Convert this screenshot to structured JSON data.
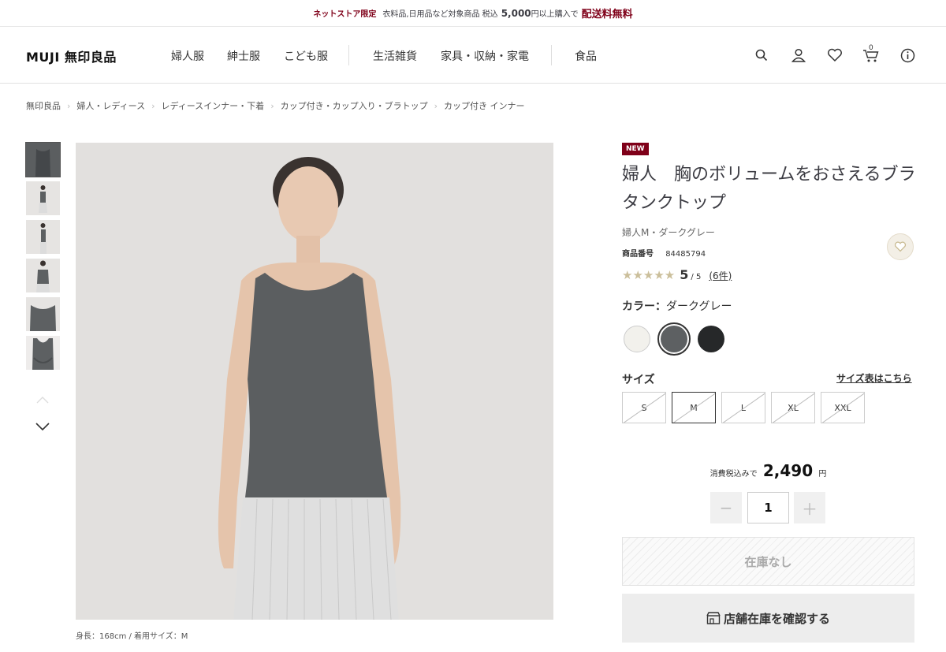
{
  "promo": {
    "tag": "ネットストア限定",
    "text": "衣料品,日用品など対象商品 税込",
    "amount": "5,000",
    "suffix": "円以上購入で",
    "highlight": "配送料無料"
  },
  "header": {
    "logo": "MUJI 無印良品",
    "nav": [
      "婦人服",
      "紳士服",
      "こども服",
      "生活雑貨",
      "家具・収納・家電",
      "食品"
    ],
    "icons": [
      "search-icon",
      "account-icon",
      "heart-icon",
      "cart-icon",
      "info-icon"
    ],
    "cart_count": "0"
  },
  "breadcrumb": [
    "無印良品",
    "婦人・レディース",
    "レディースインナー・下着",
    "カップ付き・カップ入り・ブラトップ",
    "カップ付き インナー"
  ],
  "gallery": {
    "thumb_count": 6,
    "caption": "身長：168cm / 着用サイズ：M"
  },
  "product": {
    "badge": "NEW",
    "title": "婦人　胸のボリュームをおさえるブラタンクトップ",
    "variant": "婦人M・ダークグレー",
    "sku_label": "商品番号",
    "sku": "84485794",
    "stars": "★★★★★",
    "score": "5",
    "out_of": "/ 5",
    "reviews": "(6件)",
    "color_label": "カラー：",
    "color_value": "ダークグレー",
    "colors": [
      {
        "name": "オフ白",
        "hex": "#f2f1ec"
      },
      {
        "name": "ダークグレー",
        "hex": "#5d6062"
      },
      {
        "name": "黒",
        "hex": "#262829"
      }
    ],
    "size_label": "サイズ",
    "size_chart_link": "サイズ表はこちら",
    "sizes": [
      "S",
      "M",
      "L",
      "XL",
      "XXL"
    ],
    "selected_size": "M",
    "price_prefix": "消費税込みで",
    "price": "2,490",
    "currency": "円",
    "qty_minus": "−",
    "qty": "1",
    "qty_plus": "＋",
    "soldout_label": "在庫なし",
    "store_button": "店舗在庫を確認する"
  },
  "colors": {
    "brand_red": "#7f0019",
    "star": "#cbbf9b"
  }
}
